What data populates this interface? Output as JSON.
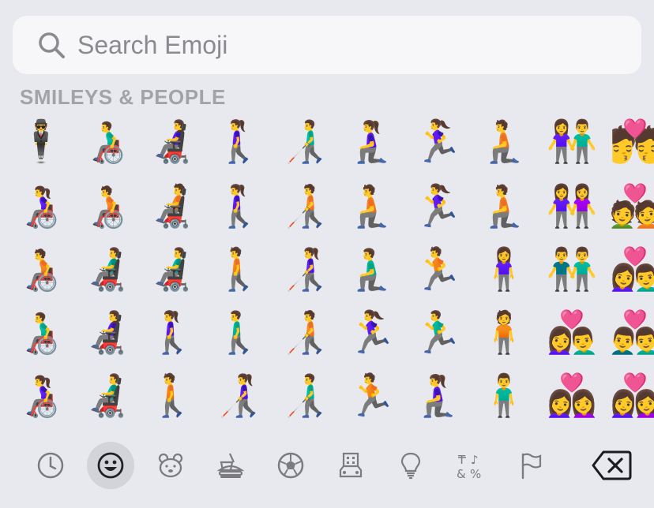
{
  "search": {
    "placeholder": "Search Emoji"
  },
  "section": {
    "title": "SMILEYS & PEOPLE"
  },
  "emoji_rows": [
    [
      "🕴",
      "👨‍🦽",
      "👩‍🦼",
      "🚶‍♀️",
      "👨‍🦯",
      "🧎‍♀️",
      "🏃‍♀️",
      "🧎",
      "👫",
      "💏"
    ],
    [
      "👩‍🦽",
      "🧑‍🦽",
      "🧑‍🦼",
      "🚶‍♀️",
      "🧑‍🦯",
      "🧎",
      "🏃‍♀️",
      "🧎",
      "👭",
      "💑"
    ],
    [
      "🧑‍🦽",
      "👨‍🦼",
      "👨‍🦼",
      "🚶",
      "👩‍🦯",
      "🧎‍♂️",
      "🏃",
      "🧍‍♀️",
      "👬",
      "👩‍❤️‍👨"
    ],
    [
      "👨‍🦽",
      "👩‍🦼",
      "🚶‍♀️",
      "🚶‍♂️",
      "🧑‍🦯",
      "🏃‍♀️",
      "🏃‍♂️",
      "🧍",
      "👩‍❤️‍👨",
      "👨‍❤️‍👨"
    ],
    [
      "👩‍🦽",
      "👨‍🦼",
      "🚶",
      "👩‍🦯",
      "👨‍🦯",
      "🏃",
      "🧎‍♀️",
      "🧍‍♂️",
      "👩‍❤️‍👩",
      "👩‍❤️‍👩"
    ]
  ],
  "categories": [
    {
      "name": "recent",
      "icon": "clock-icon",
      "active": false
    },
    {
      "name": "smileys-people",
      "icon": "smiley-icon",
      "active": true
    },
    {
      "name": "animals-nature",
      "icon": "bear-icon",
      "active": false
    },
    {
      "name": "food-drink",
      "icon": "burger-icon",
      "active": false
    },
    {
      "name": "activity",
      "icon": "soccer-ball-icon",
      "active": false
    },
    {
      "name": "travel-places",
      "icon": "building-car-icon",
      "active": false
    },
    {
      "name": "objects",
      "icon": "lightbulb-icon",
      "active": false
    },
    {
      "name": "symbols",
      "icon": "symbols-icon",
      "active": false
    },
    {
      "name": "flags",
      "icon": "flag-icon",
      "active": false
    }
  ],
  "delete_icon": "delete-backspace-icon",
  "colors": {
    "background": "#e8e9ee",
    "search_bg": "#f7f7fa",
    "active_tab": "#d2d4da",
    "icon": "#7b7b80"
  }
}
